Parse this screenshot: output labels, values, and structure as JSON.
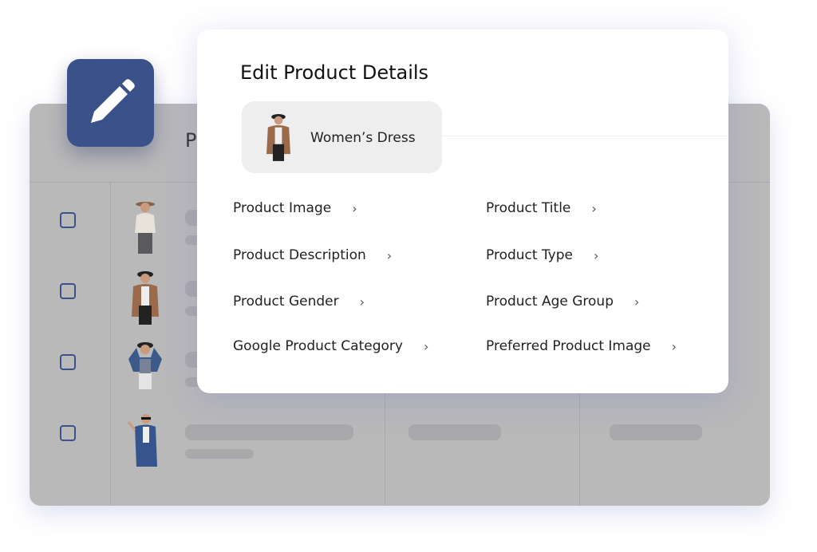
{
  "background_table": {
    "header_partial_text": "P",
    "rows": [
      {
        "figure": "woman-hat-white-blouse",
        "coat_color": "#e8e2da"
      },
      {
        "figure": "woman-hat-brown-coat",
        "coat_color": "#9a6a4a"
      },
      {
        "figure": "woman-hat-denim-jacket",
        "coat_color": "#3b5a8a"
      },
      {
        "figure": "woman-sunglasses-blue-coat",
        "coat_color": "#36548e"
      }
    ]
  },
  "edit_tile": {
    "icon": "pencil-icon",
    "color": "#3b5189"
  },
  "modal": {
    "title": "Edit Product Details",
    "product_chip": {
      "label": "Women’s Dress"
    },
    "items": [
      {
        "label": "Product Image"
      },
      {
        "label": "Product Title"
      },
      {
        "label": "Product Description"
      },
      {
        "label": "Product Type"
      },
      {
        "label": "Product Gender"
      },
      {
        "label": "Product Age Group"
      },
      {
        "label": "Google Product Category"
      },
      {
        "label": "Preferred Product Image"
      }
    ],
    "chevron": "›"
  }
}
